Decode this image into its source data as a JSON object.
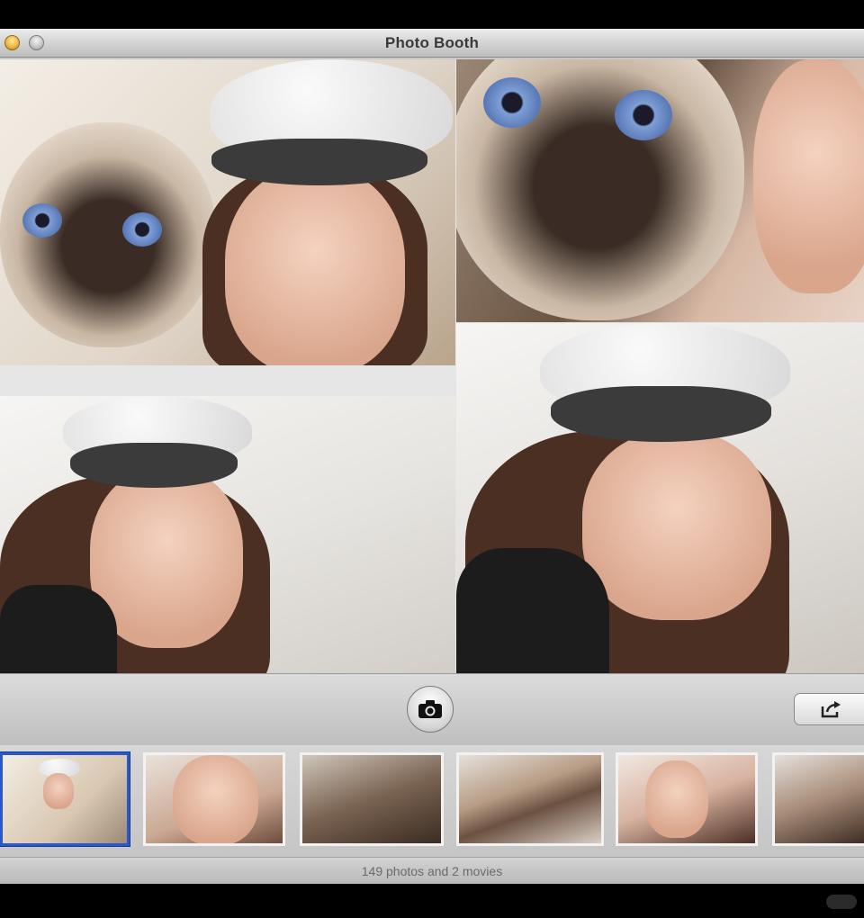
{
  "window": {
    "title": "Photo Booth",
    "controls": [
      "close",
      "minimize"
    ]
  },
  "main_photos": [
    {
      "alt": "selfie with siamese cat and white cap"
    },
    {
      "alt": "close-up of siamese cat face"
    },
    {
      "alt": "winking selfie in white cap"
    },
    {
      "alt": "winking selfie in white cap, closer"
    }
  ],
  "toolbar": {
    "shutter_icon": "camera-icon",
    "share_icon": "share-arrow-icon"
  },
  "thumbnails": [
    {
      "alt": "girl in white cap holding cat",
      "selected": true
    },
    {
      "alt": "funny face pulling cheeks",
      "selected": false
    },
    {
      "alt": "person holding cat",
      "selected": false
    },
    {
      "alt": "siamese cat",
      "selected": false
    },
    {
      "alt": "girl with star earring",
      "selected": false
    },
    {
      "alt": "two people making faces",
      "selected": false
    }
  ],
  "status": {
    "text": "149 photos and 2 movies"
  },
  "colors": {
    "selection": "#2a57c9",
    "chrome": "#c8c8c8"
  }
}
